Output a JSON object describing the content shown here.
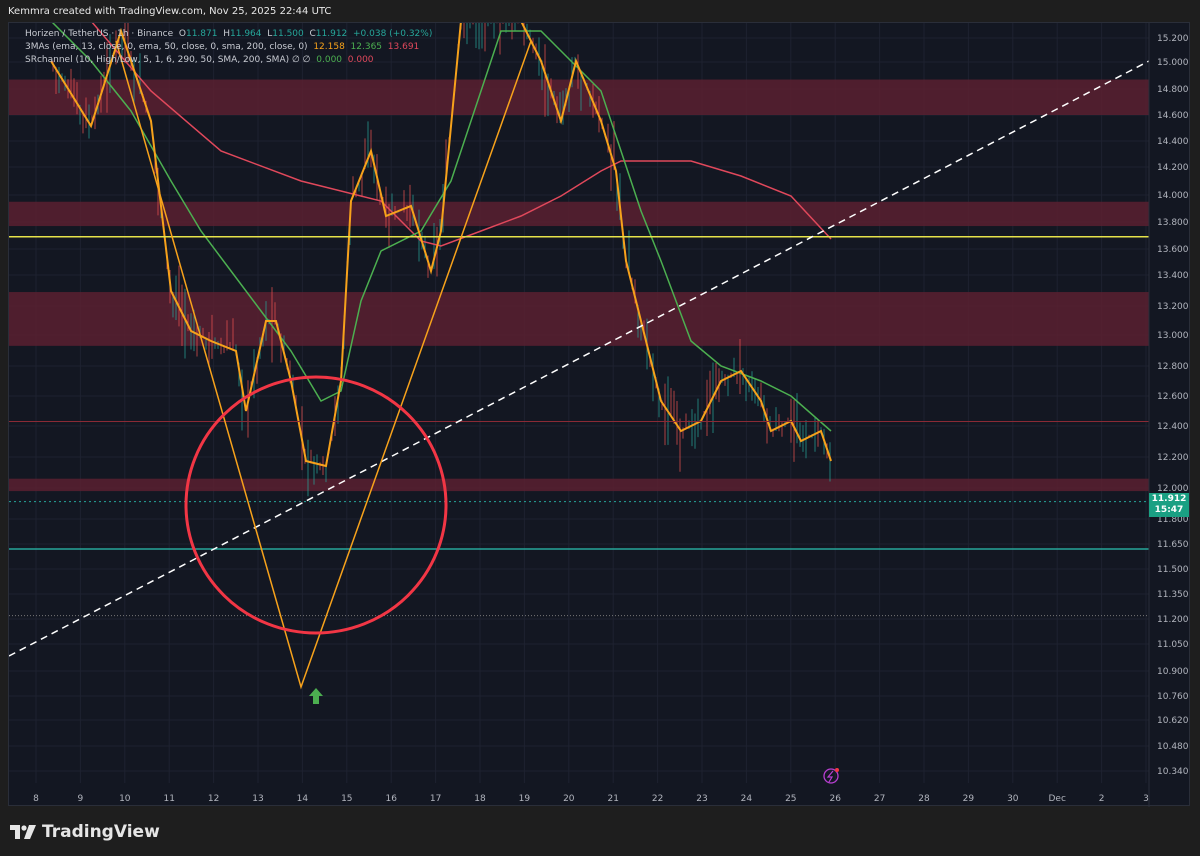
{
  "caption": "Kemmra created with TradingView.com, Nov 25, 2025 22:44 UTC",
  "legend": {
    "symbol": "Horizen / TetherUS · 1h · Binance",
    "o_label": "O",
    "o": "11.871",
    "h_label": "H",
    "h": "11.964",
    "l_label": "L",
    "l": "11.500",
    "c_label": "C",
    "c": "11.912",
    "change": "+0.038 (+0.32%)",
    "mas_label": "3MAs (ema, 13, close, 0, ema, 50, close, 0, sma, 200, close, 0)",
    "ma1": "12.158",
    "ma2": "12.365",
    "ma3": "13.691",
    "sr_label": "SRchannel (10, High/Low, 5, 1, 6, 290, 50, SMA, 200, SMA)  ∅  ∅",
    "sr1": "0.000",
    "sr2": "0.000"
  },
  "price_axis": [
    "15.200",
    "15.000",
    "14.800",
    "14.600",
    "14.400",
    "14.200",
    "14.000",
    "13.800",
    "13.600",
    "13.400",
    "13.200",
    "13.000",
    "12.800",
    "12.600",
    "12.400",
    "12.200",
    "12.000",
    "11.800",
    "11.650",
    "11.500",
    "11.350",
    "11.200",
    "11.050",
    "10.900",
    "10.760",
    "10.620",
    "10.480",
    "10.340"
  ],
  "time_axis": [
    "8",
    "9",
    "10",
    "11",
    "12",
    "13",
    "14",
    "15",
    "16",
    "17",
    "18",
    "19",
    "20",
    "21",
    "22",
    "23",
    "24",
    "25",
    "26",
    "27",
    "28",
    "29",
    "30",
    "Dec",
    "2",
    "3"
  ],
  "last_price": {
    "price": "11.912",
    "countdown": "15:47"
  },
  "zones": [
    [
      14.6,
      14.87
    ],
    [
      13.77,
      13.95
    ],
    [
      12.93,
      13.29
    ],
    [
      11.98,
      12.06
    ]
  ],
  "levels": {
    "yellow": 13.691,
    "teal": 11.62,
    "red_thin": 12.43,
    "dotted_last": 11.912,
    "dotted_low": 11.22
  },
  "colors": {
    "bg": "#131722",
    "zone": "#5a2030",
    "ema13": "#f7a21b",
    "ema50": "#4caf50",
    "sma200": "#e0485b",
    "teal": "#26a69a",
    "yellow": "#e6e34a",
    "circle": "#f23645",
    "arrow": "#4caf50"
  },
  "logo": "TradingView"
}
